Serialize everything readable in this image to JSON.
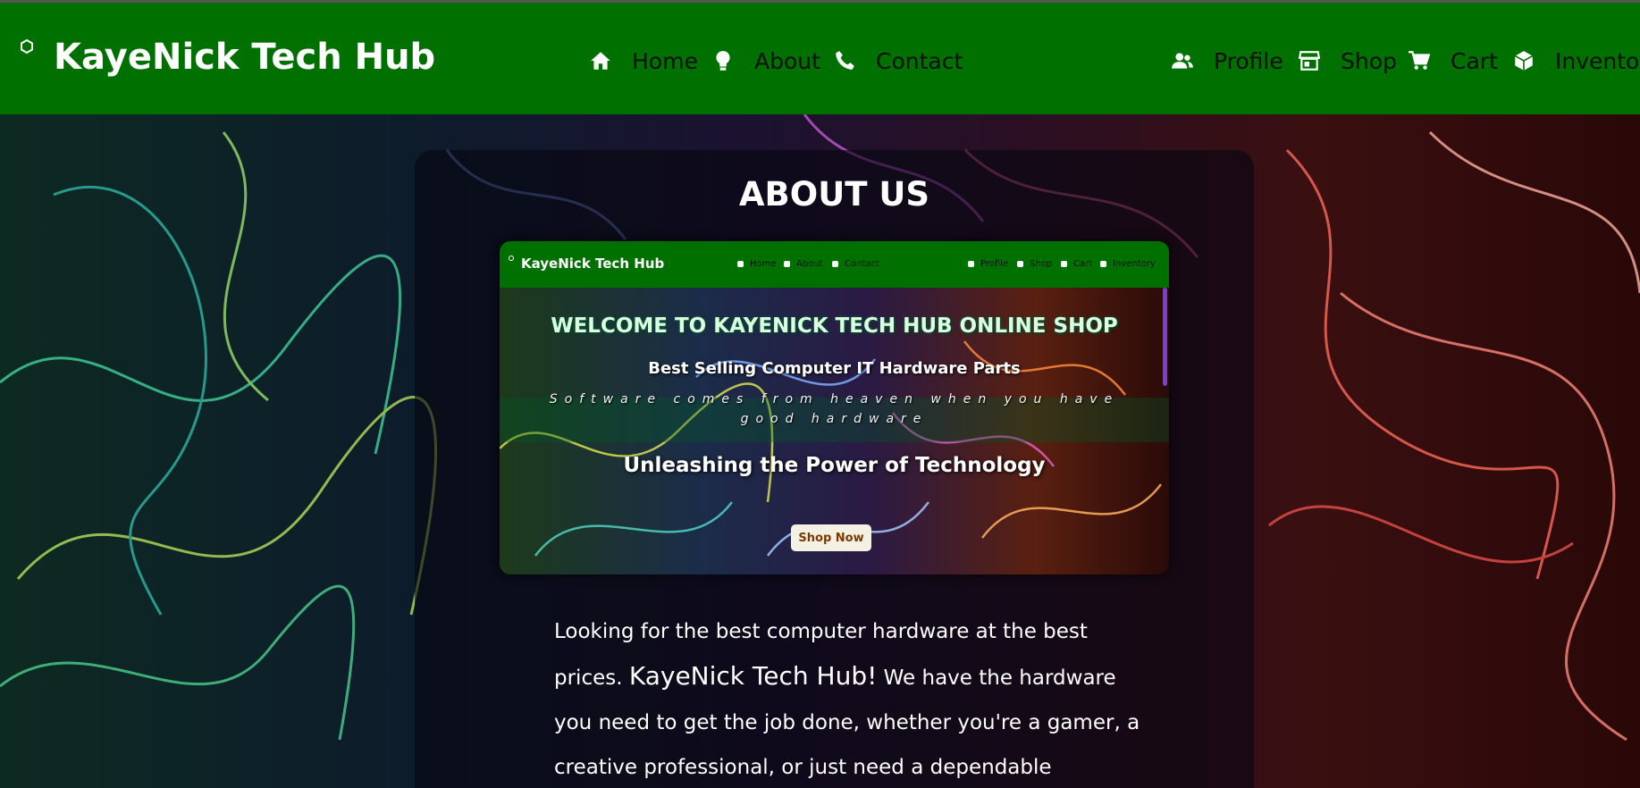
{
  "navbar": {
    "brand": "KayeNick Tech Hub",
    "items": [
      {
        "label": "Home",
        "icon": "home-icon"
      },
      {
        "label": "About",
        "icon": "lightbulb-icon"
      },
      {
        "label": "Contact",
        "icon": "phone-icon"
      },
      {
        "label": "Profile",
        "icon": "users-icon"
      },
      {
        "label": "Shop",
        "icon": "store-icon"
      },
      {
        "label": "Cart",
        "icon": "cart-icon"
      },
      {
        "label": "Inventor",
        "icon": "cube-icon"
      }
    ],
    "bg_color": "#007000"
  },
  "about": {
    "title": "ABOUT US",
    "preview": {
      "brand": "KayeNick Tech Hub",
      "nav": [
        "Home",
        "About",
        "Contact",
        "Profile",
        "Shop",
        "Cart",
        "Inventory"
      ],
      "welcome": "WELCOME TO KAYENICK TECH HUB ONLINE SHOP",
      "best_selling": "Best Selling Computer IT Hardware Parts",
      "tagline": "Software comes from heaven when you have good hardware",
      "unleash": "Unleashing the Power of Technology",
      "shop_now": "Shop Now"
    },
    "text_before": "Looking for the best computer hardware at the best prices. ",
    "highlight": "KayeNick Tech Hub!",
    "text_after": " We have the hardware you need to get the job done, whether you're a gamer, a creative professional, or just need a dependable"
  }
}
